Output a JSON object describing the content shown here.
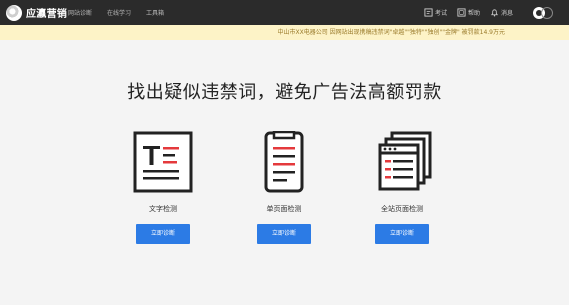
{
  "header": {
    "brand": "应瀛营销",
    "nav": [
      "网站诊断",
      "在线学习",
      "工具箱"
    ],
    "tools": {
      "exam": "考试",
      "help": "帮助",
      "message": "消息"
    }
  },
  "notice": "中山市XX电器公司 因网站出现携稿违禁词\"卓越\"\"独特\"\"独创\"\"金牌\" 被罚款14.9万元",
  "main": {
    "headline": "找出疑似违禁词，避免广告法高额罚款",
    "features": [
      {
        "label": "文字检测",
        "button": "立即诊断",
        "icon": "text-check-icon"
      },
      {
        "label": "单页面检测",
        "button": "立即诊断",
        "icon": "single-page-icon"
      },
      {
        "label": "全站页面检测",
        "button": "立即诊断",
        "icon": "multi-page-icon"
      }
    ]
  },
  "colors": {
    "accent": "#2c7be5",
    "highlight": "#e4393c",
    "topbar": "#2b2b2b",
    "notice_bg": "#fdf3c7"
  }
}
